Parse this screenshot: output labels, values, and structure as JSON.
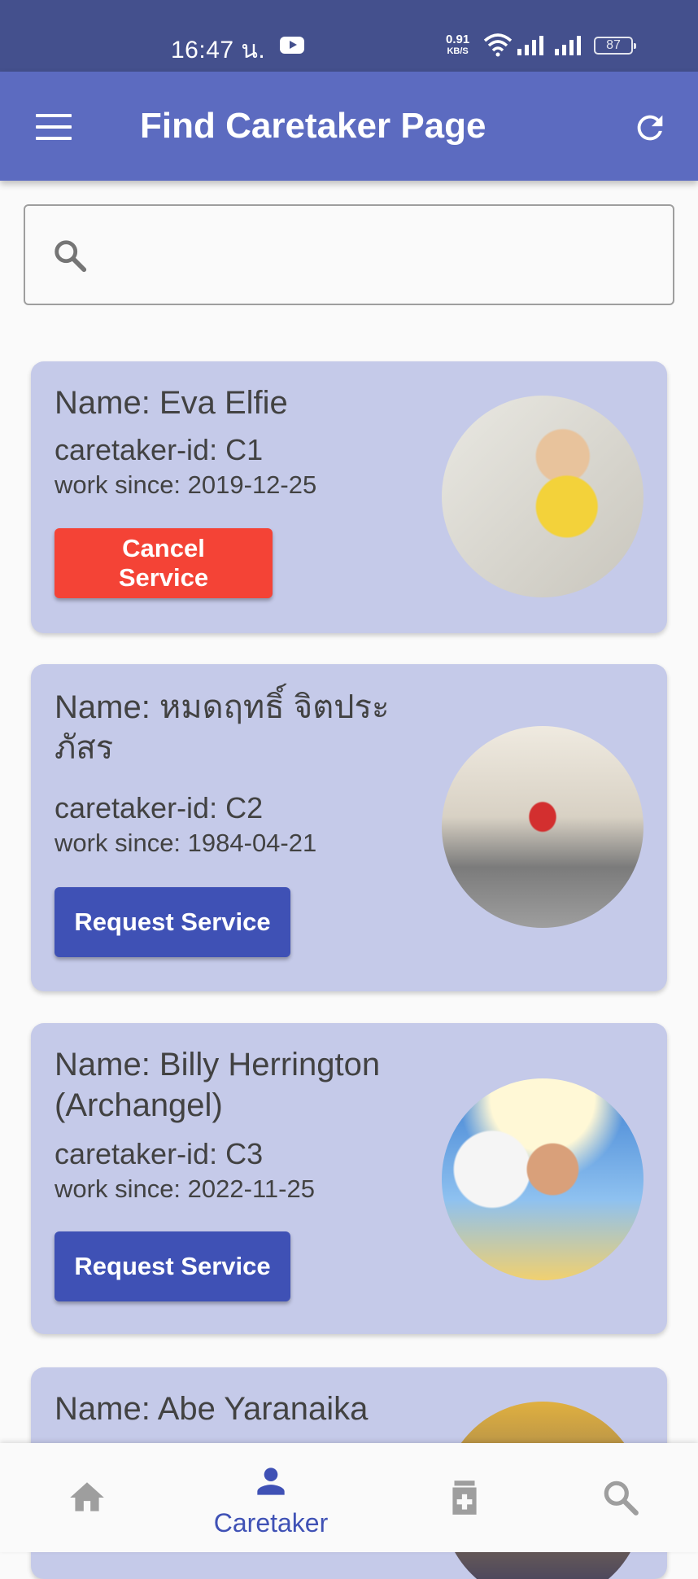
{
  "status_bar": {
    "time": "16:47 น.",
    "speed_value": "0.91",
    "speed_unit": "KB/S",
    "battery": "87"
  },
  "app_bar": {
    "title": "Find Caretaker Page",
    "menu_icon": "menu-icon",
    "refresh_icon": "refresh-icon"
  },
  "search": {
    "icon": "search-icon",
    "value": "",
    "placeholder": ""
  },
  "caretakers": [
    {
      "name": "Name: Eva Elfie",
      "id": "caretaker-id: C1",
      "since": "work since: 2019-12-25",
      "button": "Cancel Service"
    },
    {
      "name": "Name: หมดฤทธิ์ จิตประภัสร",
      "id": "caretaker-id: C2",
      "since": "work since: 1984-04-21",
      "button": "Request Service"
    },
    {
      "name": "Name: Billy Herrington (Archangel)",
      "id": "caretaker-id: C3",
      "since": "work since: 2022-11-25",
      "button": "Request Service"
    },
    {
      "name": "Name: Abe Yaranaika"
    }
  ],
  "bottom_nav": {
    "items": [
      {
        "icon": "home-icon",
        "label": ""
      },
      {
        "icon": "person-icon",
        "label": "Caretaker"
      },
      {
        "icon": "medicine-icon",
        "label": ""
      },
      {
        "icon": "search-icon",
        "label": ""
      }
    ],
    "active_index": 1
  },
  "colors": {
    "status_bar": "#44508d",
    "app_bar": "#5c6bc0",
    "card": "#c5cae9",
    "cancel_button": "#f44336",
    "request_button": "#3f51b5",
    "active_nav": "#3f51b5",
    "inactive_nav": "#9e9e9e"
  }
}
